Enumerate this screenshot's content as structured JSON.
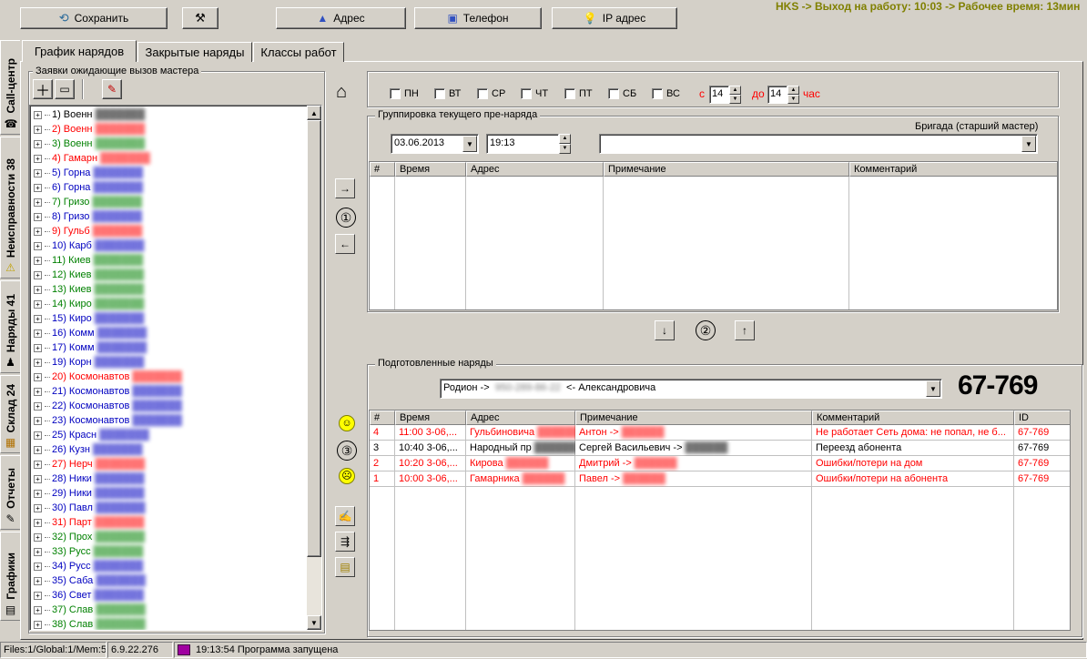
{
  "toolbar": {
    "save": "Сохранить",
    "address": "Адрес",
    "phone": "Телефон",
    "ip": "IP адрес",
    "banner": "HKS -> Выход на работу: 10:03 -> Рабочее время: 13мин"
  },
  "side_tabs": [
    {
      "label": "Call-центр",
      "icon": "phone-icon"
    },
    {
      "label": "Неисправности 38",
      "icon": "warning-icon"
    },
    {
      "label": "Наряды 41",
      "icon": "workers-icon"
    },
    {
      "label": "Склад 24",
      "icon": "box-icon"
    },
    {
      "label": "Отчеты",
      "icon": "report-icon"
    },
    {
      "label": "Графики",
      "icon": "chart-icon"
    }
  ],
  "tabs": [
    "График нарядов",
    "Закрытые наряды",
    "Классы работ"
  ],
  "left_panel": {
    "title": "Заявки ожидающие вызов мастера",
    "items": [
      {
        "num": "1)",
        "text": "Военн",
        "color": "#000000"
      },
      {
        "num": "2)",
        "text": "Военн",
        "color": "#ff0000"
      },
      {
        "num": "3)",
        "text": "Военн",
        "color": "#008000"
      },
      {
        "num": "4)",
        "text": "Гамарн",
        "color": "#ff0000"
      },
      {
        "num": "5)",
        "text": "Горна",
        "color": "#0000c0"
      },
      {
        "num": "6)",
        "text": "Горна",
        "color": "#0000c0"
      },
      {
        "num": "7)",
        "text": "Гризо",
        "color": "#008000"
      },
      {
        "num": "8)",
        "text": "Гризо",
        "color": "#0000c0"
      },
      {
        "num": "9)",
        "text": "Гульб",
        "color": "#ff0000"
      },
      {
        "num": "10)",
        "text": "Карб",
        "color": "#0000c0"
      },
      {
        "num": "11)",
        "text": "Киев",
        "color": "#008000"
      },
      {
        "num": "12)",
        "text": "Киев",
        "color": "#008000"
      },
      {
        "num": "13)",
        "text": "Киев",
        "color": "#008000"
      },
      {
        "num": "14)",
        "text": "Киро",
        "color": "#008000"
      },
      {
        "num": "15)",
        "text": "Киро",
        "color": "#0000c0"
      },
      {
        "num": "16)",
        "text": "Комм",
        "color": "#0000c0"
      },
      {
        "num": "17)",
        "text": "Комм",
        "color": "#0000c0"
      },
      {
        "num": "19)",
        "text": "Корн",
        "color": "#0000c0"
      },
      {
        "num": "20)",
        "text": "Космонавтов",
        "color": "#ff0000"
      },
      {
        "num": "21)",
        "text": "Космонавтов",
        "color": "#0000c0"
      },
      {
        "num": "22)",
        "text": "Космонавтов",
        "color": "#0000c0"
      },
      {
        "num": "23)",
        "text": "Космонавтов",
        "color": "#0000c0"
      },
      {
        "num": "25)",
        "text": "Красн",
        "color": "#0000c0"
      },
      {
        "num": "26)",
        "text": "Кузн",
        "color": "#0000c0"
      },
      {
        "num": "27)",
        "text": "Нерч",
        "color": "#ff0000"
      },
      {
        "num": "28)",
        "text": "Ники",
        "color": "#0000c0"
      },
      {
        "num": "29)",
        "text": "Ники",
        "color": "#0000c0"
      },
      {
        "num": "30)",
        "text": "Павл",
        "color": "#0000c0"
      },
      {
        "num": "31)",
        "text": "Парт",
        "color": "#ff0000"
      },
      {
        "num": "32)",
        "text": "Прох",
        "color": "#008000"
      },
      {
        "num": "33)",
        "text": "Русс",
        "color": "#008000"
      },
      {
        "num": "34)",
        "text": "Русс",
        "color": "#0000c0"
      },
      {
        "num": "35)",
        "text": "Саба",
        "color": "#0000c0"
      },
      {
        "num": "36)",
        "text": "Свет",
        "color": "#0000c0"
      },
      {
        "num": "37)",
        "text": "Слав",
        "color": "#008000"
      },
      {
        "num": "38)",
        "text": "Слав",
        "color": "#008000"
      }
    ]
  },
  "days": {
    "labels": [
      "ПН",
      "ВТ",
      "СР",
      "ЧТ",
      "ПТ",
      "СБ",
      "ВС"
    ],
    "from_label": "с",
    "from_value": "14",
    "to_label": "до",
    "to_value": "14",
    "unit": "час"
  },
  "grouping": {
    "title": "Группировка текущего пре-наряда",
    "brigade_label": "Бригада (старший мастер)",
    "date": "03.06.2013",
    "time": "19:13",
    "columns": [
      "#",
      "Время",
      "Адрес",
      "Примечание",
      "Комментарий"
    ]
  },
  "prepared": {
    "title": "Подготовленные наряды",
    "selected_prefix": "Родион ->",
    "selected_suffix": "<- Александровича",
    "big_code": "67-769",
    "columns": [
      "#",
      "Время",
      "Адрес",
      "Примечание",
      "Комментарий",
      "ID"
    ],
    "rows": [
      {
        "num": "4",
        "time": "11:00 3-06,...",
        "addr": "Гульбиновича",
        "note": "Антон ->",
        "comment": "Не работает Сеть дома: не попал, не б...",
        "id": "67-769",
        "color": "#ff0000"
      },
      {
        "num": "3",
        "time": "10:40 3-06,...",
        "addr": "Народный пр",
        "note": "Сергей Васильевич ->",
        "comment": "Переезд абонента",
        "id": "67-769",
        "color": "#000000"
      },
      {
        "num": "2",
        "time": "10:20 3-06,...",
        "addr": "Кирова",
        "note": "Дмитрий ->",
        "comment": "Ошибки/потери на дом",
        "id": "67-769",
        "color": "#ff0000"
      },
      {
        "num": "1",
        "time": "10:00 3-06,...",
        "addr": "Гамарника",
        "note": "Павел ->",
        "comment": "Ошибки/потери на абонента",
        "id": "67-769",
        "color": "#ff0000"
      }
    ]
  },
  "circles": [
    "①",
    "②",
    "③"
  ],
  "status": {
    "files": "Files:1/Global:1/Mem:5",
    "version": "6.9.22.276",
    "message": "19:13:54 Программа запущена"
  },
  "colors": {
    "banner": "#808000",
    "red": "#ff0000",
    "green": "#008000",
    "blue": "#0000c0"
  }
}
